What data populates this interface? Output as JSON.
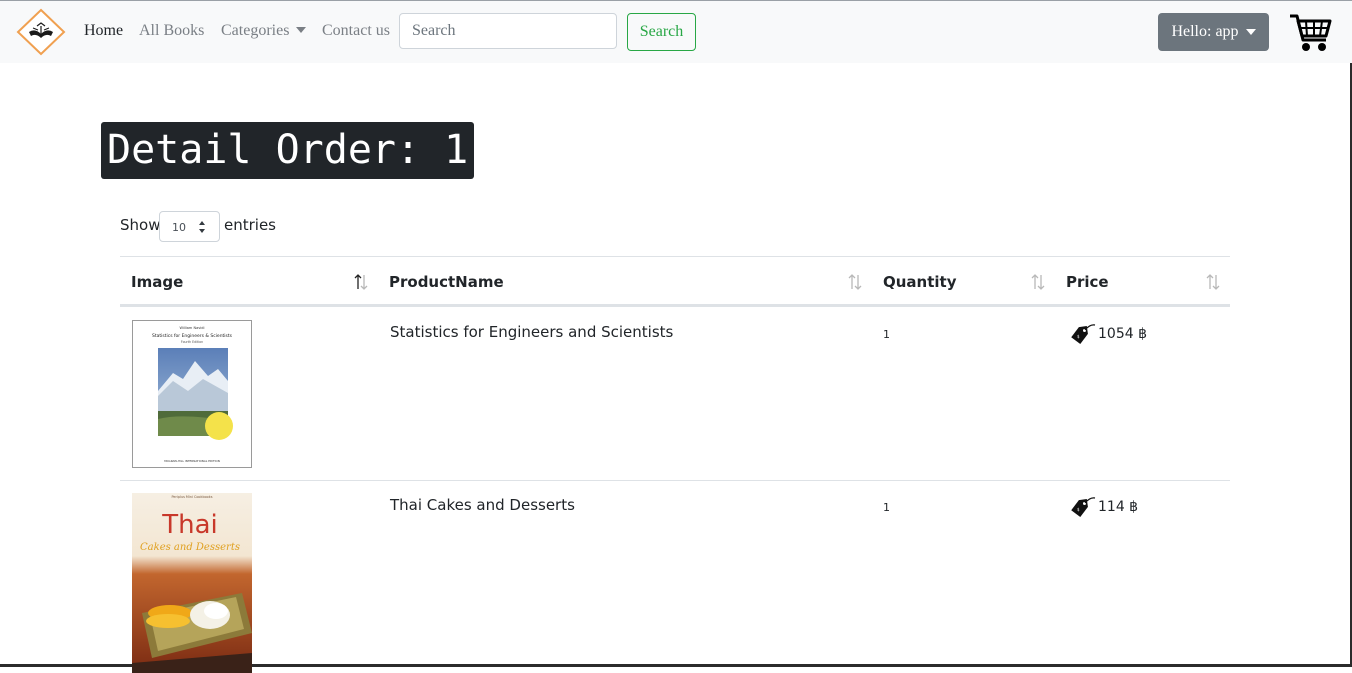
{
  "nav": {
    "links": [
      "Home",
      "All Books",
      "Categories",
      "Contact us"
    ],
    "search_placeholder": "Search",
    "search_button": "Search",
    "user_menu": "Hello: app",
    "icons": [
      "book-logo-icon",
      "cart-icon"
    ]
  },
  "page": {
    "title": "Detail Order: 1"
  },
  "table_controls": {
    "show_label": "Show",
    "page_length": "10",
    "entries_label": "entries"
  },
  "table": {
    "columns": [
      "Image",
      "ProductName",
      "Quantity",
      "Price"
    ],
    "rows": [
      {
        "product_name": "Statistics for Engineers and Scientists",
        "quantity": "1",
        "price": "1054 ฿",
        "cover": {
          "author": "William Navidi",
          "title": "Statistics for Engineers & Scientists",
          "edition": "Fourth Edition",
          "footer": "MCGRAW-HILL INTERNATIONAL EDITION"
        }
      },
      {
        "product_name": "Thai Cakes and Desserts",
        "quantity": "1",
        "price": "114 ฿",
        "cover": {
          "author": "Periplus Mini Cookbooks",
          "title": "Thai",
          "subtitle": "Cakes and Desserts"
        }
      }
    ]
  }
}
